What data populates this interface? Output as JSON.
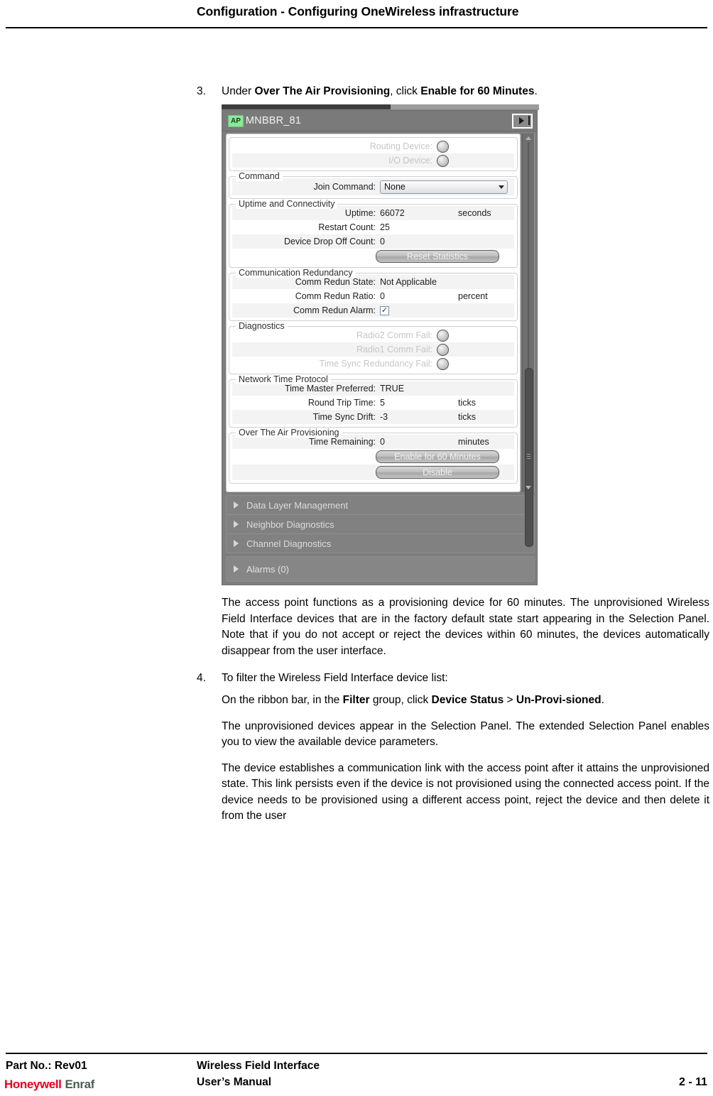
{
  "header": {
    "title": "Configuration - Configuring OneWireless infrastructure"
  },
  "steps": [
    {
      "number": "3.",
      "text_parts": {
        "a": "Under ",
        "b1": "Over The Air Provisioning",
        "c": ", click ",
        "b2": "Enable for 60 Minutes",
        "d": "."
      }
    },
    {
      "number": "4.",
      "text": "To filter the Wireless Field Interface device list:"
    }
  ],
  "paragraphs": {
    "after_figure": "The access point functions as a provisioning device for 60 minutes. The unprovisioned Wireless Field Interface devices that are in the factory default state start appearing in the Selection Panel. Note that if you do not accept or reject the devices within 60 minutes, the devices automatically disappear from the user interface.",
    "filter_instruction": {
      "a": "On the ribbon bar, in the ",
      "b1": "Filter",
      "c": " group, click ",
      "b2": "Device Status",
      "d": " > ",
      "b3": "Un-Provi-sioned",
      "e": "."
    },
    "unprovisioned": "The unprovisioned devices appear in the Selection Panel. The extended Selection Panel enables you to view the available device parameters.",
    "comm_link": "The device establishes a communication link with the access point after it attains the unprovisioned state. This link persists even if the device is not provisioned using the connected access point. If the device needs to be provisioned using a different access point, reject the device and then delete it from the user"
  },
  "dialog": {
    "badge": "AP",
    "title": "MNBBR_81",
    "expand_icon": "expand-right-icon",
    "top_section": {
      "rows": [
        {
          "label": "Routing Device:",
          "indicator": "led-off"
        },
        {
          "label": "I/O Device:",
          "indicator": "led-off"
        }
      ]
    },
    "groups": [
      {
        "legend": "Command",
        "rows": [
          {
            "label": "Join Command:",
            "control": "combobox",
            "value": "None"
          }
        ]
      },
      {
        "legend": "Uptime and Connectivity",
        "rows": [
          {
            "label": "Uptime:",
            "value": "66072",
            "unit": "seconds"
          },
          {
            "label": "Restart Count:",
            "value": "25",
            "unit": ""
          },
          {
            "label": "Device Drop Off Count:",
            "value": "0",
            "unit": ""
          }
        ],
        "buttons": [
          "Reset Statistics"
        ]
      },
      {
        "legend": "Communication Redundancy",
        "rows": [
          {
            "label": "Comm Redun State:",
            "value": "Not Applicable",
            "unit": ""
          },
          {
            "label": "Comm Redun Ratio:",
            "value": "0",
            "unit": "percent"
          },
          {
            "label": "Comm Redun Alarm:",
            "control": "checkbox",
            "checked": true
          }
        ]
      },
      {
        "legend": "Diagnostics",
        "rows": [
          {
            "label": "Radio2 Comm Fail:",
            "indicator": "led-off"
          },
          {
            "label": "Radio1 Comm Fail:",
            "indicator": "led-off"
          },
          {
            "label": "Time Sync Redundancy Fail:",
            "indicator": "led-off"
          }
        ]
      },
      {
        "legend": "Network Time Protocol",
        "rows": [
          {
            "label": "Time Master Preferred:",
            "value": "TRUE",
            "unit": ""
          },
          {
            "label": "Round Trip Time:",
            "value": "5",
            "unit": "ticks"
          },
          {
            "label": "Time Sync Drift:",
            "value": "-3",
            "unit": "ticks"
          }
        ]
      },
      {
        "legend": "Over The Air Provisioning",
        "rows": [
          {
            "label": "Time Remaining:",
            "value": "0",
            "unit": "minutes"
          }
        ],
        "buttons": [
          "Enable for 60 Minutes",
          "Disable"
        ]
      }
    ],
    "accordions": [
      "Data Layer Management",
      "Neighbor Diagnostics",
      "Channel Diagnostics"
    ],
    "alarms": "Alarms (0)",
    "scrollbar": {
      "up_icon": "scroll-up-icon",
      "down_icon": "scroll-down-icon"
    }
  },
  "footer": {
    "part_no": "Part No.: Rev01",
    "logo_honeywell": "Honeywell",
    "logo_enraf": "Enraf",
    "line1": "Wireless Field Interface",
    "line2": "User’s Manual",
    "page": "2 - 11"
  }
}
